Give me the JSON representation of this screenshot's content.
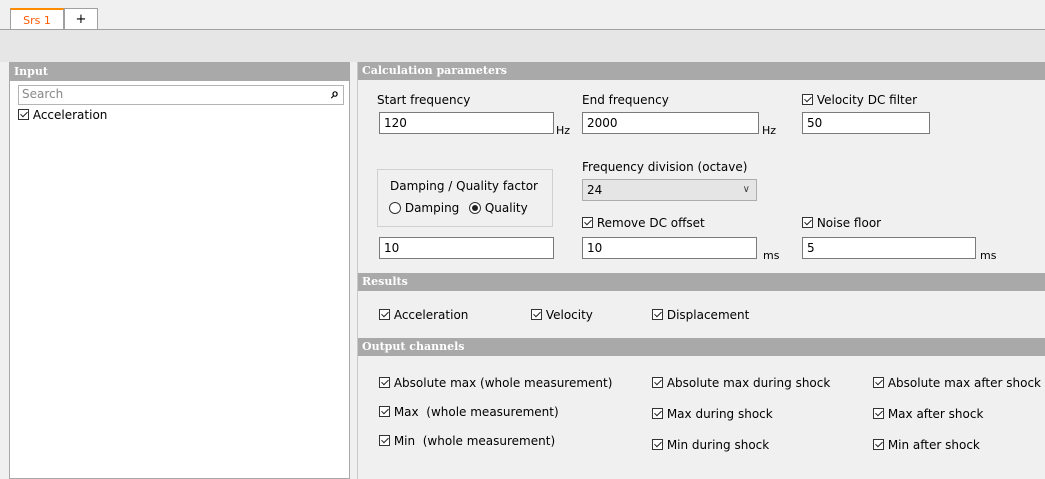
{
  "tabs": [
    {
      "label": "Srs 1",
      "active": true
    },
    {
      "label": "+"
    }
  ],
  "input_panel": {
    "header": "Input",
    "search_placeholder": "Search",
    "items": [
      {
        "label": "Acceleration",
        "checked": true
      }
    ]
  },
  "calc": {
    "header": "Calculation parameters",
    "start_frequency": {
      "label": "Start frequency",
      "value": "120",
      "unit": "Hz"
    },
    "end_frequency": {
      "label": "End frequency",
      "value": "2000",
      "unit": "Hz"
    },
    "velocity_dc_filter": {
      "label": "Velocity DC filter",
      "checked": true,
      "value": "50"
    },
    "damping_group": {
      "title": "Damping / Quality factor",
      "options": [
        "Damping",
        "Quality"
      ],
      "selected": "Quality",
      "value": "10"
    },
    "frequency_division": {
      "label": "Frequency division (octave)",
      "value": "24"
    },
    "remove_dc_offset": {
      "label": "Remove DC offset",
      "checked": true,
      "value": "10",
      "unit": "ms"
    },
    "noise_floor": {
      "label": "Noise floor",
      "checked": true,
      "value": "5",
      "unit": "ms"
    }
  },
  "results": {
    "header": "Results",
    "items": [
      {
        "label": "Acceleration",
        "checked": true
      },
      {
        "label": "Velocity",
        "checked": true
      },
      {
        "label": "Displacement",
        "checked": true
      }
    ]
  },
  "output": {
    "header": "Output channels",
    "col1": [
      {
        "label": "Absolute max (whole measurement)",
        "checked": true
      },
      {
        "label": "Max  (whole measurement)",
        "checked": true
      },
      {
        "label": "Min  (whole measurement)",
        "checked": true
      }
    ],
    "col2": [
      {
        "label": "Absolute max during shock",
        "checked": true
      },
      {
        "label": "Max during shock",
        "checked": true
      },
      {
        "label": "Min during shock",
        "checked": true
      }
    ],
    "col3": [
      {
        "label": "Absolute max after shock",
        "checked": true
      },
      {
        "label": "Max after shock",
        "checked": true
      },
      {
        "label": "Min after shock",
        "checked": true
      }
    ]
  },
  "colors": {
    "active_tab_text": "#ff5a00",
    "header_bg": "#a9a9a9"
  }
}
